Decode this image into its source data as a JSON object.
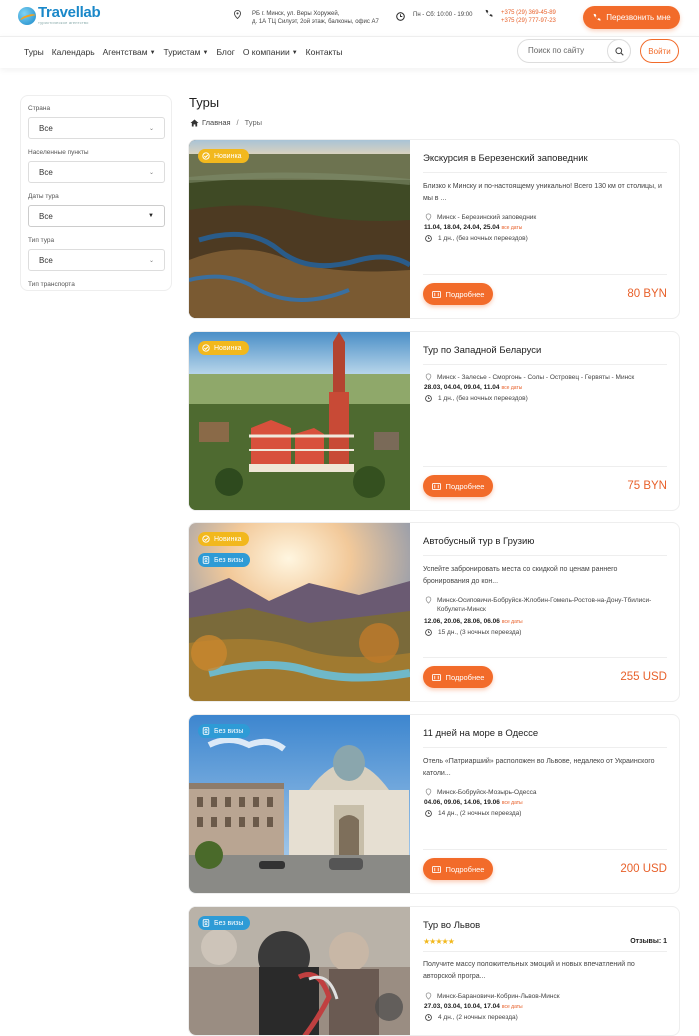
{
  "header": {
    "logo_name": "Travellab",
    "logo_tagline": "туристическое агентство",
    "address_line1": "РБ г. Минск, ул. Веры Хоружей,",
    "address_line2": "д. 1А ТЦ Силуэт, 2ой этаж, балконы, офис А7",
    "hours": "Пн - Сб: 10:00 - 19:00",
    "phone1": "+375 (29) 369-45-89",
    "phone2": "+375 (29) 777-97-23",
    "callback_label": "Перезвонить мне"
  },
  "nav": {
    "items": [
      {
        "label": "Туры",
        "dropdown": false
      },
      {
        "label": "Календарь",
        "dropdown": false
      },
      {
        "label": "Агентствам",
        "dropdown": true
      },
      {
        "label": "Туристам",
        "dropdown": true
      },
      {
        "label": "Блог",
        "dropdown": false
      },
      {
        "label": "О компании",
        "dropdown": true
      },
      {
        "label": "Контакты",
        "dropdown": false
      }
    ],
    "search_placeholder": "Поиск по сайту",
    "login_label": "Войти"
  },
  "filters": [
    {
      "label": "Страна",
      "value": "Все"
    },
    {
      "label": "Населенные пункты",
      "value": "Все"
    },
    {
      "label": "Даты тура",
      "value": "Все"
    },
    {
      "label": "Тип тура",
      "value": "Все"
    },
    {
      "label": "Тип транспорта",
      "value": ""
    }
  ],
  "page": {
    "title": "Туры",
    "breadcrumb_home": "Главная",
    "breadcrumb_sep": "/",
    "breadcrumb_current": "Туры"
  },
  "badges": {
    "new": "Новинка",
    "visa": "Без визы"
  },
  "all_dates_label": "все даты",
  "details_label": "Подробнее",
  "tours": [
    {
      "title": "Экскурсия в Березенский заповедник",
      "desc": "Близко к Минску и по-настоящему уникально! Всего 130 км от столицы, и мы в ...",
      "route": "Минск - Березинский заповедник",
      "dates": "11.04, 18.04, 24.04, 25.04",
      "duration": "1 дн., (без ночных переездов)",
      "price": "80 BYN"
    },
    {
      "title": "Тур по Западной Беларуси",
      "desc": "",
      "route": "Минск - Залесье - Сморгонь - Солы - Островец - Гервяты - Минск",
      "dates": "28.03, 04.04, 09.04, 11.04",
      "duration": "1 дн., (без ночных переездов)",
      "price": "75 BYN"
    },
    {
      "title": "Автобусный тур в Грузию",
      "desc": "Успейте забронировать места со скидкой по ценам раннего бронирования до кон...",
      "route": "Минск-Осиповичи-Бобруйск-Жлобин-Гомель-Ростов-на-Дону-Тбилиси-Кобулети-Минск",
      "dates": "12.06, 20.06, 28.06, 06.06",
      "duration": "15 дн., (3 ночных переезда)",
      "price": "255 USD"
    },
    {
      "title": "11 дней на море в Одессе",
      "desc": "Отель «Патриарший» расположен во Львове, недалеко от Украинского католи...",
      "route": "Минск-Бобруйск-Мозырь-Одесса",
      "dates": "04.06, 09.06, 14.06, 19.06",
      "duration": "14 дн., (2 ночных переезда)",
      "price": "200 USD"
    },
    {
      "title": "Тур во Львов",
      "stars": "★★★★★",
      "reviews": "Отзывы: 1",
      "desc": "Получите массу положительных эмоций и новых впечатлений по авторской програ...",
      "route": "Минск-Барановичи-Кобрин-Львов-Минск",
      "dates": "27.03, 03.04, 10.04, 17.04",
      "duration": "4 дн., (2 ночных переезда)",
      "price": ""
    }
  ],
  "colors": {
    "accent": "#f26b2a",
    "brand": "#1a88c9",
    "badge_new": "#f2b81d",
    "badge_visa": "#2e9bd6"
  }
}
